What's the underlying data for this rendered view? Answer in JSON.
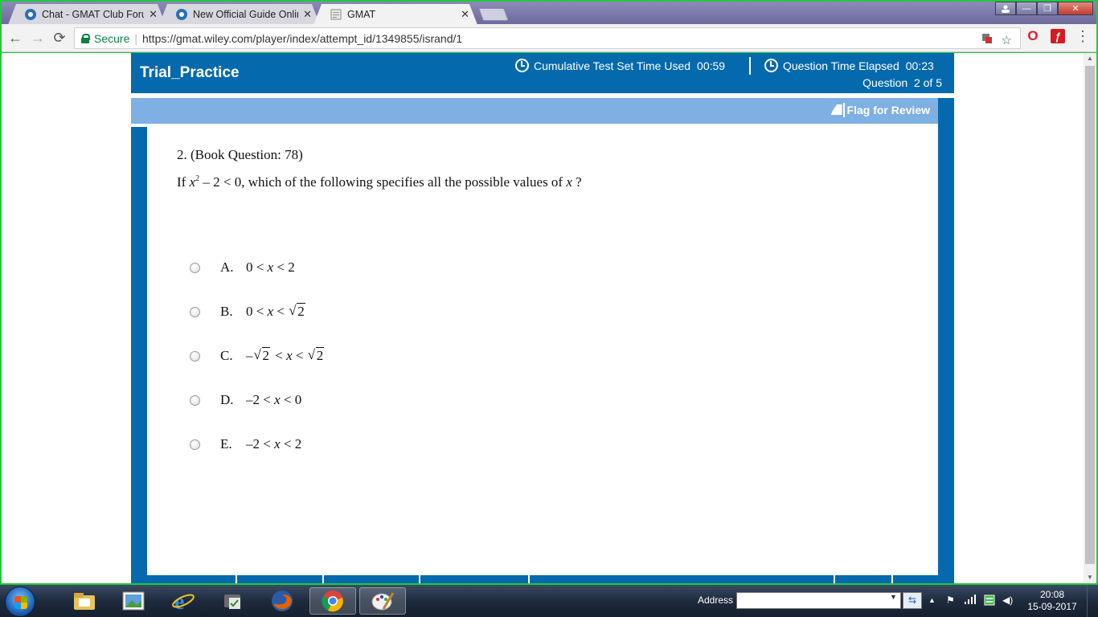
{
  "browser": {
    "tabs": [
      {
        "title": "Chat - GMAT Club Forum",
        "close": "✕",
        "active": false,
        "icon": "gmatclub-icon"
      },
      {
        "title": "New Official Guide Online",
        "close": "✕",
        "active": false,
        "icon": "gmatclub-icon"
      },
      {
        "title": "GMAT",
        "close": "✕",
        "active": true,
        "icon": "page-icon"
      }
    ],
    "window_controls": {
      "minimize": "—",
      "maximize": "❐",
      "close": "✕"
    },
    "nav": {
      "back": "←",
      "forward": "→",
      "reload": "⟳"
    },
    "omnibox": {
      "secure_label": "Secure",
      "separator": "|",
      "url": "https://gmat.wiley.com/player/index/attempt_id/1349855/isrand/1"
    },
    "omnibox_icons": {
      "star": "☆",
      "menu": "⋮"
    },
    "extensions": [
      {
        "name": "opera-icon",
        "glyph": "O",
        "color": "#e0182d"
      },
      {
        "name": "flash-icon",
        "glyph": "ƒ",
        "color": "#d71920"
      }
    ]
  },
  "player": {
    "test_name": "Trial_Practice",
    "cumulative_label": "Cumulative Test Set Time Used",
    "cumulative_time": "00:59",
    "question_time_label": "Question Time Elapsed",
    "question_time": "00:23",
    "question_counter": "Question  2 of 5",
    "flag_label": "Flag for Review"
  },
  "question": {
    "number": "2. (Book Question: 78)",
    "stem": {
      "prefix": "If ",
      "var": "x",
      "exp": "2",
      "middle": " – 2 < 0, which of the following specifies all the possible values of ",
      "var2": "x",
      "suffix": " ?"
    },
    "options": [
      {
        "letter": "A.",
        "parts": {
          "a": "0 < ",
          "x": "x",
          "b": " < 2"
        }
      },
      {
        "letter": "B.",
        "parts": {
          "a": "0 < ",
          "x": "x",
          "b": " < ",
          "sqrt": "2"
        }
      },
      {
        "letter": "C.",
        "parts": {
          "neg": "–",
          "sqrt1": "2",
          "a": " < ",
          "x": "x",
          "b": " < ",
          "sqrt2": "2"
        }
      },
      {
        "letter": "D.",
        "parts": {
          "a": "–2 < ",
          "x": "x",
          "b": " < 0"
        }
      },
      {
        "letter": "E.",
        "parts": {
          "a": "–2 < ",
          "x": "x",
          "b": " < 2"
        }
      }
    ]
  },
  "taskbar": {
    "apps": [
      "explorer-icon",
      "image-viewer-icon",
      "internet-explorer-icon",
      "tools-icon",
      "firefox-icon",
      "chrome-icon",
      "paint-icon"
    ],
    "address_label": "Address",
    "address_value": "",
    "go_glyph": "⇆",
    "tray": {
      "chevron": "▲",
      "flag": "⚑",
      "signal": "▮",
      "battery": "▬",
      "volume": "◀)"
    },
    "time": "20:08",
    "date": "15-09-2017"
  },
  "colors": {
    "header_blue": "#0569ad",
    "flag_bar_blue": "#7eb0e3",
    "secure_green": "#0b8043",
    "window_border_green": "#22c83a"
  }
}
